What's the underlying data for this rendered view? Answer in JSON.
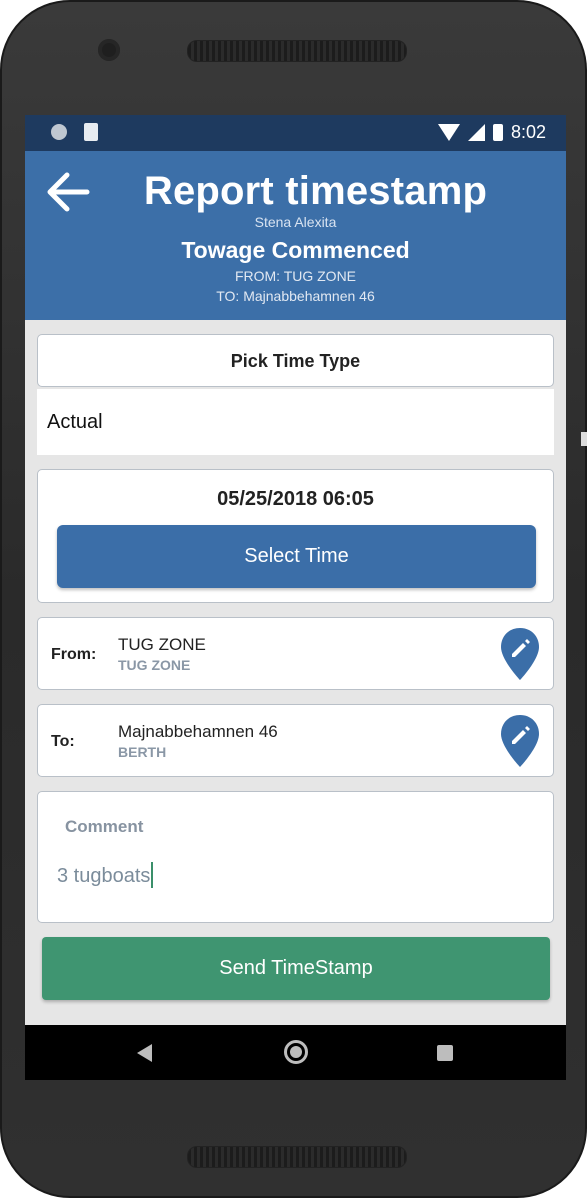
{
  "status_bar": {
    "time": "8:02",
    "icons": [
      "circle-notification-icon",
      "sd-card-icon",
      "wifi-icon",
      "signal-icon",
      "battery-icon"
    ]
  },
  "header": {
    "title": "Report timestamp",
    "vessel": "Stena Alexita",
    "event": "Towage Commenced",
    "from_line": "FROM: TUG ZONE",
    "to_line": "TO: Majnabbehamnen 46",
    "color": "#3c6fa8"
  },
  "time_type": {
    "title": "Pick Time Type",
    "selected": "Actual"
  },
  "time": {
    "value": "05/25/2018 06:05",
    "select_label": "Select Time"
  },
  "from": {
    "label": "From:",
    "name": "TUG ZONE",
    "type": "TUG ZONE"
  },
  "to": {
    "label": "To:",
    "name": "Majnabbehamnen 46",
    "type": "BERTH"
  },
  "comment": {
    "label": "Comment",
    "value": "3 tugboats"
  },
  "send": {
    "label": "Send TimeStamp",
    "color": "#3f9571"
  }
}
